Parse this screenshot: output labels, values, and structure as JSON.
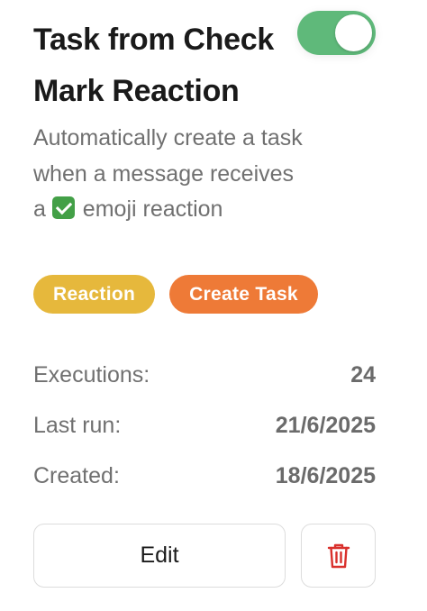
{
  "workflow": {
    "title": "Task from Check Mark Reaction",
    "enabled": true,
    "description_before_emoji": "Automatically create a task when a message receives a",
    "description_after_emoji": " emoji reaction",
    "emoji_icon": "check-mark-button-emoji"
  },
  "tags": [
    {
      "label": "Reaction",
      "color": "#e6b83c"
    },
    {
      "label": "Create Task",
      "color": "#ee7a37"
    }
  ],
  "stats": [
    {
      "label": "Executions:",
      "value": "24"
    },
    {
      "label": "Last run:",
      "value": "21/6/2025"
    },
    {
      "label": "Created:",
      "value": "18/6/2025"
    }
  ],
  "actions": {
    "edit_label": "Edit",
    "delete_icon": "trash-icon"
  },
  "colors": {
    "toggle_on": "#5fb97a",
    "delete_icon": "#d9302c"
  }
}
